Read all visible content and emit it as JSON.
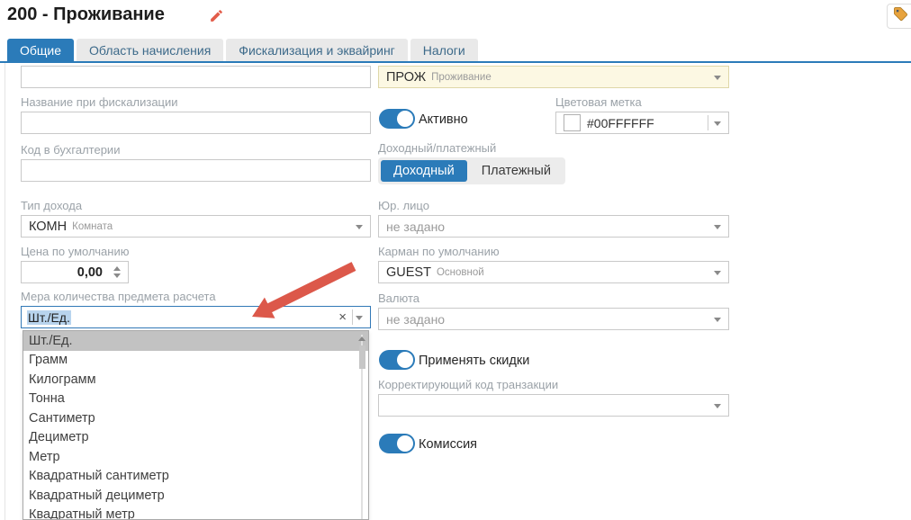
{
  "header": {
    "title": "200 - Проживание"
  },
  "tabs": [
    {
      "label": "Общие",
      "active": true
    },
    {
      "label": "Область начисления",
      "active": false
    },
    {
      "label": "Фискализация и эквайринг",
      "active": false
    },
    {
      "label": "Налоги",
      "active": false
    }
  ],
  "form": {
    "name_input": {
      "value": ""
    },
    "fiscal_name": {
      "label": "Название при фискализации",
      "value": ""
    },
    "accounting_code": {
      "label": "Код в бухгалтерии",
      "value": ""
    },
    "income_type": {
      "label": "Тип дохода",
      "value_code": "КОМН",
      "value_name": "Комната"
    },
    "default_price": {
      "label": "Цена по умолчанию",
      "value": "0,00"
    },
    "quantity_measure": {
      "label": "Мера количества предмета расчета",
      "value": "Шт./Ед."
    },
    "service_code": {
      "value_code": "ПРОЖ",
      "value_name": "Проживание"
    },
    "active": {
      "label": "Активно",
      "state": "on"
    },
    "color_mark": {
      "label": "Цветовая метка",
      "value": "#00FFFFFF"
    },
    "income_payment": {
      "label": "Доходный/платежный",
      "option_income": "Доходный",
      "option_payment": "Платежный",
      "selected": "Доходный"
    },
    "legal_entity": {
      "label": "Юр. лицо",
      "value": "не задано"
    },
    "default_pocket": {
      "label": "Карман по умолчанию",
      "value_code": "GUEST",
      "value_name": "Основной"
    },
    "currency": {
      "label": "Валюта",
      "value": "не задано"
    },
    "apply_discounts": {
      "label": "Применять скидки",
      "state": "on"
    },
    "correction_code": {
      "label": "Корректирующий код транзакции",
      "value": ""
    },
    "commission": {
      "label": "Комиссия",
      "state": "on"
    }
  },
  "measure_dropdown": {
    "items": [
      "Шт./Ед.",
      "Грамм",
      "Килограмм",
      "Тонна",
      "Сантиметр",
      "Дециметр",
      "Метр",
      "Квадратный сантиметр",
      "Квадратный дециметр",
      "Квадратный метр"
    ],
    "highlighted_index": 0
  },
  "icons": {
    "edit": "pencil-icon",
    "corner": "tag-icon",
    "annotation": "red-arrow"
  },
  "colors": {
    "accent_blue": "#2b7bb9",
    "highlight_yellow": "#fcf8e3",
    "annotation_red": "#dc584a",
    "list_highlight": "#c2c2c2"
  }
}
